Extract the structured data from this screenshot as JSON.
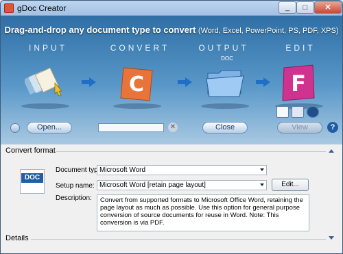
{
  "window": {
    "title": "gDoc Creator",
    "controls": {
      "minimize": "_",
      "maximize": "□",
      "close": "✕"
    }
  },
  "banner": {
    "headline": "Drag-and-drop any document type to convert",
    "formats": "(Word, Excel, PowerPoint, PS, PDF, XPS)",
    "steps": {
      "input": "INPUT",
      "convert": "CONVERT",
      "output": "OUTPUT",
      "edit": "EDIT"
    },
    "output_format": "DOC",
    "convert_letter": "C",
    "edit_letter": "F",
    "icons": [
      "drop-document-icon",
      "convert-icon",
      "folder-icon",
      "foxit-edit-icon",
      "doc-format-icon",
      "spreadsheet-format-icon",
      "web-format-icon"
    ]
  },
  "toolbar": {
    "open_label": "Open...",
    "close_label": "Close",
    "view_label": "View",
    "help_label": "?",
    "clear_label": "✕"
  },
  "convert_format": {
    "section_title": "Convert format",
    "doc_icon_label": "DOC",
    "document_type_label": "Document type:",
    "document_type_value": "Microsoft Word",
    "setup_name_label": "Setup name:",
    "setup_name_value": "Microsoft Word [retain page layout]",
    "edit_label": "Edit...",
    "description_label": "Description:",
    "description_text": "Convert from supported formats to Microsoft Office Word, retaining the page layout as much as possible. Use this option for general purpose conversion of source documents for reuse in Word. Note: This conversion is via PDF."
  },
  "details": {
    "section_title": "Details"
  },
  "colors": {
    "banner_top": "#2f6fa5",
    "accent": "#1f6fc8",
    "convert_orange": "#e8743a",
    "edit_magenta": "#d0338f"
  }
}
